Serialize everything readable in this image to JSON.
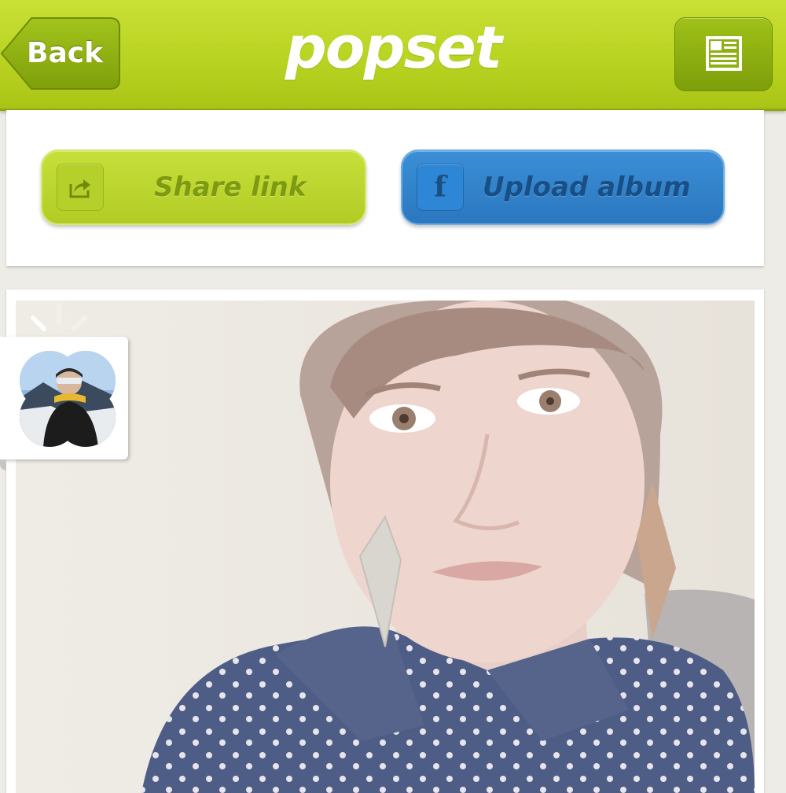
{
  "header": {
    "back_label": "Back",
    "brand": "popset",
    "icons": {
      "back": "back-arrow-shape",
      "menu": "newspaper-icon"
    }
  },
  "share": {
    "share_link_label": "Share link",
    "share_icon": "share-arrow-icon",
    "upload_album_label": "Upload album",
    "upload_icon": "facebook-icon"
  },
  "photo": {
    "loading_indicator": "spinner-icon"
  },
  "colors": {
    "header_green": "#b7d21f",
    "share_green": "#bdd62f",
    "facebook_blue": "#2f80cb",
    "background": "#eeece7"
  }
}
